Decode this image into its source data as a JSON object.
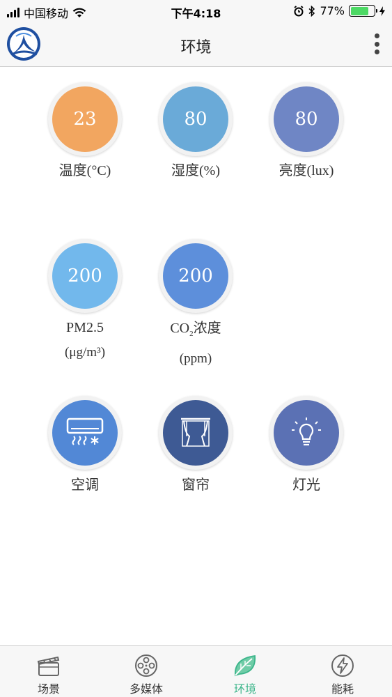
{
  "status_bar": {
    "carrier": "中国移动",
    "time": "下午4:18",
    "battery": "77%",
    "battery_level": 0.77
  },
  "nav": {
    "title": "环境"
  },
  "sensors": [
    {
      "value": "23",
      "label": "温度(°C)",
      "color": "#f2a660"
    },
    {
      "value": "80",
      "label": "湿度(%)",
      "color": "#6aaad8"
    },
    {
      "value": "80",
      "label": "亮度(lux)",
      "color": "#6f86c5"
    },
    {
      "value": "200",
      "label": "PM2.5",
      "unit": "(μg/m³)",
      "color": "#72b8ec"
    },
    {
      "value": "200",
      "label_prefix": "CO",
      "label_sub": "2",
      "label_suffix": "浓度",
      "unit": "(ppm)",
      "color": "#5d8fdb"
    }
  ],
  "devices": [
    {
      "label": "空调",
      "icon": "air-conditioner-icon",
      "color": "#5288d6"
    },
    {
      "label": "窗帘",
      "icon": "curtain-icon",
      "color": "#3e5a94"
    },
    {
      "label": "灯光",
      "icon": "light-bulb-icon",
      "color": "#5b71b4"
    }
  ],
  "tabs": [
    {
      "label": "场景",
      "icon": "clapperboard-icon"
    },
    {
      "label": "多媒体",
      "icon": "film-reel-icon"
    },
    {
      "label": "环境",
      "icon": "leaf-icon",
      "active": true
    },
    {
      "label": "能耗",
      "icon": "lightning-icon"
    }
  ],
  "colors": {
    "active_tab": "#3bb58a",
    "battery": "#4cd964"
  }
}
